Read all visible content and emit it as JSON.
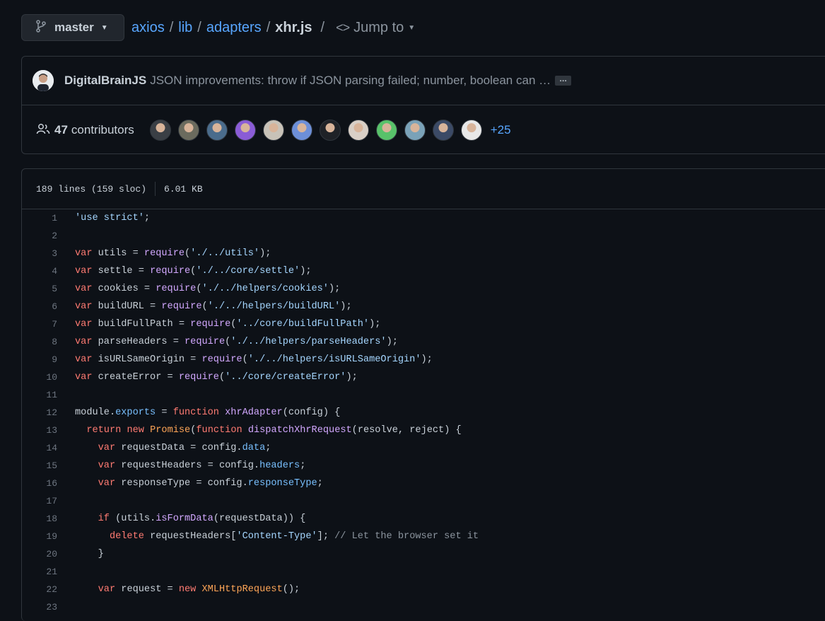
{
  "nav": {
    "branch": "master",
    "crumbs": [
      "axios",
      "lib",
      "adapters"
    ],
    "file": "xhr.js",
    "jump_label": "Jump to"
  },
  "commit": {
    "author": "DigitalBrainJS",
    "message": "JSON improvements: throw if JSON parsing failed; number, boolean can …",
    "ellipsis": "…"
  },
  "contributors": {
    "count": "47",
    "label": "contributors",
    "more": "+25",
    "avatar_colors": [
      "#3a3f45",
      "#6b6b5e",
      "#4a6c8c",
      "#8a5cd6",
      "#c8c2b8",
      "#6d8fd8",
      "#1f2227",
      "#d9cfc6",
      "#58c26a",
      "#7aa2b8",
      "#3b4a66",
      "#e8e8e8"
    ]
  },
  "file_info": {
    "lines": "189 lines (159 sloc)",
    "size": "6.01 KB"
  },
  "colors": {
    "background": "#0d1117",
    "link": "#58a6ff",
    "keyword": "#ff7b72",
    "string": "#a5d6ff",
    "function": "#d2a8ff",
    "property": "#79c0ff",
    "constant": "#ffa657"
  },
  "code_lines": [
    [
      [
        "s",
        "'use strict'"
      ],
      [
        "t",
        ";"
      ]
    ],
    [],
    [
      [
        "k",
        "var"
      ],
      [
        "t",
        " utils = "
      ],
      [
        "f",
        "require"
      ],
      [
        "t",
        "("
      ],
      [
        "s",
        "'./../utils'"
      ],
      [
        "t",
        ");"
      ]
    ],
    [
      [
        "k",
        "var"
      ],
      [
        "t",
        " settle = "
      ],
      [
        "f",
        "require"
      ],
      [
        "t",
        "("
      ],
      [
        "s",
        "'./../core/settle'"
      ],
      [
        "t",
        ");"
      ]
    ],
    [
      [
        "k",
        "var"
      ],
      [
        "t",
        " cookies = "
      ],
      [
        "f",
        "require"
      ],
      [
        "t",
        "("
      ],
      [
        "s",
        "'./../helpers/cookies'"
      ],
      [
        "t",
        ");"
      ]
    ],
    [
      [
        "k",
        "var"
      ],
      [
        "t",
        " buildURL = "
      ],
      [
        "f",
        "require"
      ],
      [
        "t",
        "("
      ],
      [
        "s",
        "'./../helpers/buildURL'"
      ],
      [
        "t",
        ");"
      ]
    ],
    [
      [
        "k",
        "var"
      ],
      [
        "t",
        " buildFullPath = "
      ],
      [
        "f",
        "require"
      ],
      [
        "t",
        "("
      ],
      [
        "s",
        "'../core/buildFullPath'"
      ],
      [
        "t",
        ");"
      ]
    ],
    [
      [
        "k",
        "var"
      ],
      [
        "t",
        " parseHeaders = "
      ],
      [
        "f",
        "require"
      ],
      [
        "t",
        "("
      ],
      [
        "s",
        "'./../helpers/parseHeaders'"
      ],
      [
        "t",
        ");"
      ]
    ],
    [
      [
        "k",
        "var"
      ],
      [
        "t",
        " isURLSameOrigin = "
      ],
      [
        "f",
        "require"
      ],
      [
        "t",
        "("
      ],
      [
        "s",
        "'./../helpers/isURLSameOrigin'"
      ],
      [
        "t",
        ");"
      ]
    ],
    [
      [
        "k",
        "var"
      ],
      [
        "t",
        " createError = "
      ],
      [
        "f",
        "require"
      ],
      [
        "t",
        "("
      ],
      [
        "s",
        "'../core/createError'"
      ],
      [
        "t",
        ");"
      ]
    ],
    [],
    [
      [
        "t",
        "module."
      ],
      [
        "p",
        "exports"
      ],
      [
        "t",
        " = "
      ],
      [
        "k",
        "function"
      ],
      [
        "t",
        " "
      ],
      [
        "f",
        "xhrAdapter"
      ],
      [
        "t",
        "(config) {"
      ]
    ],
    [
      [
        "t",
        "  "
      ],
      [
        "k",
        "return"
      ],
      [
        "t",
        " "
      ],
      [
        "k",
        "new"
      ],
      [
        "t",
        " "
      ],
      [
        "o",
        "Promise"
      ],
      [
        "t",
        "("
      ],
      [
        "k",
        "function"
      ],
      [
        "t",
        " "
      ],
      [
        "f",
        "dispatchXhrRequest"
      ],
      [
        "t",
        "(resolve, reject) {"
      ]
    ],
    [
      [
        "t",
        "    "
      ],
      [
        "k",
        "var"
      ],
      [
        "t",
        " requestData = config."
      ],
      [
        "p",
        "data"
      ],
      [
        "t",
        ";"
      ]
    ],
    [
      [
        "t",
        "    "
      ],
      [
        "k",
        "var"
      ],
      [
        "t",
        " requestHeaders = config."
      ],
      [
        "p",
        "headers"
      ],
      [
        "t",
        ";"
      ]
    ],
    [
      [
        "t",
        "    "
      ],
      [
        "k",
        "var"
      ],
      [
        "t",
        " responseType = config."
      ],
      [
        "p",
        "responseType"
      ],
      [
        "t",
        ";"
      ]
    ],
    [],
    [
      [
        "t",
        "    "
      ],
      [
        "k",
        "if"
      ],
      [
        "t",
        " (utils."
      ],
      [
        "f",
        "isFormData"
      ],
      [
        "t",
        "(requestData)) {"
      ]
    ],
    [
      [
        "t",
        "      "
      ],
      [
        "k",
        "delete"
      ],
      [
        "t",
        " requestHeaders["
      ],
      [
        "s",
        "'Content-Type'"
      ],
      [
        "t",
        "]; "
      ],
      [
        "c",
        "// Let the browser set it"
      ]
    ],
    [
      [
        "t",
        "    }"
      ]
    ],
    [],
    [
      [
        "t",
        "    "
      ],
      [
        "k",
        "var"
      ],
      [
        "t",
        " request = "
      ],
      [
        "k",
        "new"
      ],
      [
        "t",
        " "
      ],
      [
        "o",
        "XMLHttpRequest"
      ],
      [
        "t",
        "();"
      ]
    ],
    []
  ]
}
